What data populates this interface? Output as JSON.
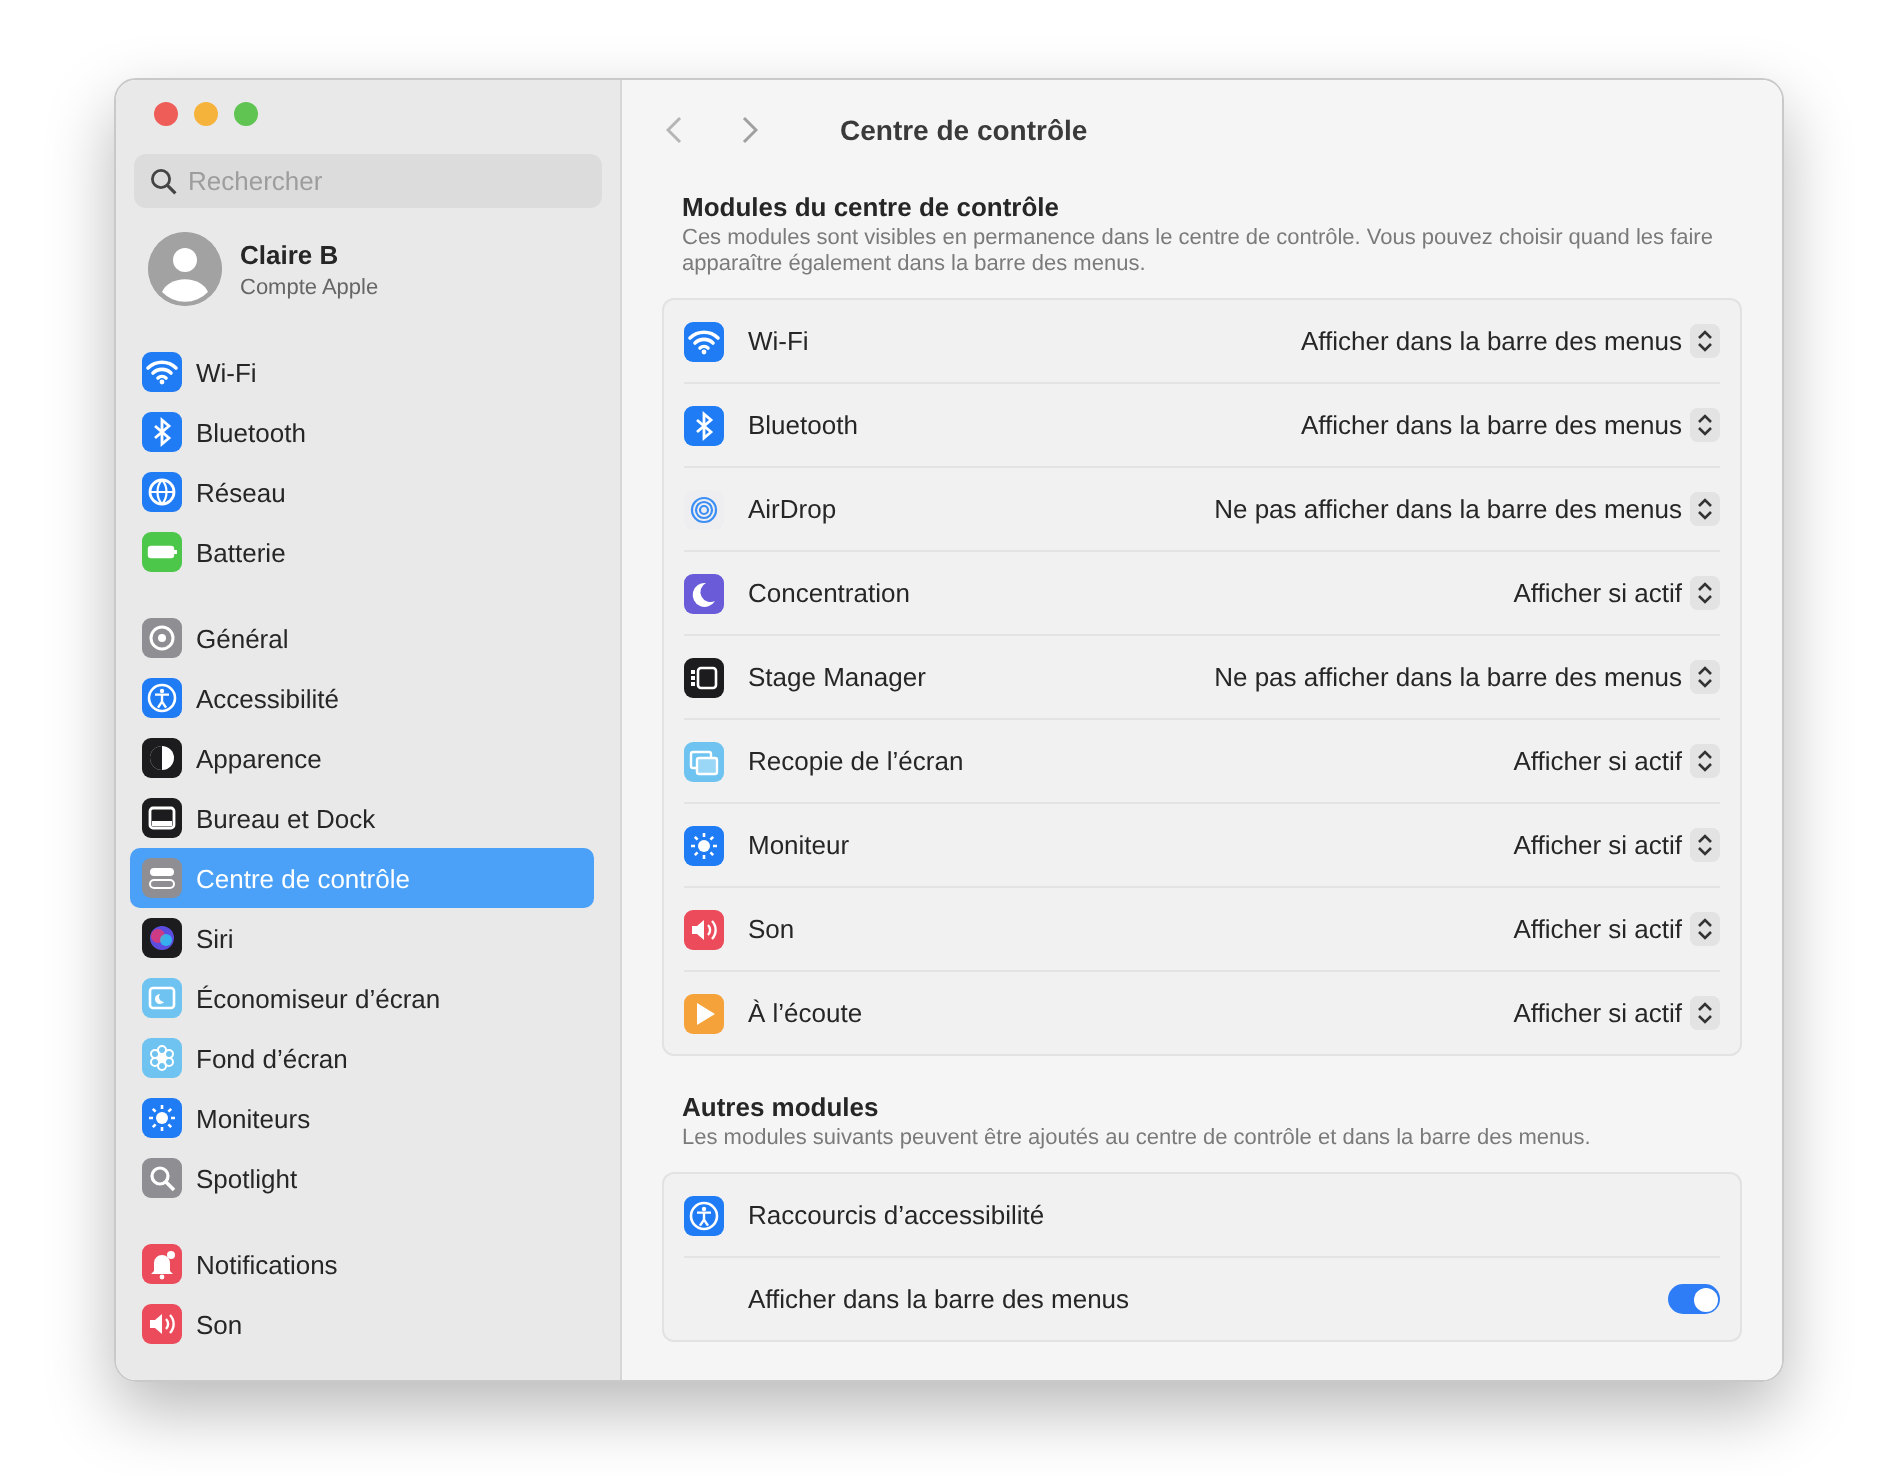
{
  "window": {
    "title": "Centre de contrôle",
    "traffic_lights": [
      {
        "kind": "close"
      },
      {
        "kind": "minimize"
      },
      {
        "kind": "zoom"
      }
    ]
  },
  "sidebar": {
    "search": {
      "placeholder": "Rechercher"
    },
    "account": {
      "name": "Claire B",
      "subtitle": "Compte Apple"
    },
    "groups": [
      [
        {
          "label": "Wi-Fi",
          "kind": "wifi",
          "selected": false
        },
        {
          "label": "Bluetooth",
          "kind": "bluetooth",
          "selected": false
        },
        {
          "label": "Réseau",
          "kind": "globe",
          "selected": false
        },
        {
          "label": "Batterie",
          "kind": "battery",
          "selected": false
        }
      ],
      [
        {
          "label": "Général",
          "kind": "gear",
          "selected": false
        },
        {
          "label": "Accessibilité",
          "kind": "accessibility",
          "selected": false
        },
        {
          "label": "Apparence",
          "kind": "appearance",
          "selected": false
        },
        {
          "label": "Bureau et Dock",
          "kind": "dock",
          "selected": false
        },
        {
          "label": "Centre de contrôle",
          "kind": "toggles",
          "selected": true
        },
        {
          "label": "Siri",
          "kind": "siri",
          "selected": false
        },
        {
          "label": "Économiseur d’écran",
          "kind": "screensaver",
          "selected": false
        },
        {
          "label": "Fond d’écran",
          "kind": "flower",
          "selected": false
        },
        {
          "label": "Moniteurs",
          "kind": "sun",
          "selected": false
        },
        {
          "label": "Spotlight",
          "kind": "magnifier",
          "selected": false
        }
      ],
      [
        {
          "label": "Notifications",
          "kind": "bell",
          "selected": false
        },
        {
          "label": "Son",
          "kind": "speaker",
          "selected": false
        }
      ]
    ]
  },
  "sections": [
    {
      "title": "Modules du centre de contrôle",
      "description": "Ces modules sont visibles en permanence dans le centre de contrôle. Vous pouvez choisir quand les faire apparaître également dans la barre des menus.",
      "rows": [
        {
          "kind": "wifi",
          "label": "Wi-Fi",
          "value": "Afficher dans la barre des menus"
        },
        {
          "kind": "bluetooth",
          "label": "Bluetooth",
          "value": "Afficher dans la barre des menus"
        },
        {
          "kind": "airdrop",
          "label": "AirDrop",
          "value": "Ne pas afficher dans la barre des menus"
        },
        {
          "kind": "moon",
          "label": "Concentration",
          "value": "Afficher si actif"
        },
        {
          "kind": "stage",
          "label": "Stage Manager",
          "value": "Ne pas afficher dans la barre des menus"
        },
        {
          "kind": "mirror",
          "label": "Recopie de l’écran",
          "value": "Afficher si actif"
        },
        {
          "kind": "sun",
          "label": "Moniteur",
          "value": "Afficher si actif"
        },
        {
          "kind": "speaker",
          "label": "Son",
          "value": "Afficher si actif"
        },
        {
          "kind": "play",
          "label": "À l’écoute",
          "value": "Afficher si actif"
        }
      ]
    },
    {
      "title": "Autres modules",
      "description": "Les modules suivants peuvent être ajoutés au centre de contrôle et dans la barre des menus.",
      "rows": [
        {
          "kind": "accessibility",
          "label": "Raccourcis d’accessibilité"
        },
        {
          "label": "Afficher dans la barre des menus",
          "on": true
        }
      ]
    }
  ]
}
